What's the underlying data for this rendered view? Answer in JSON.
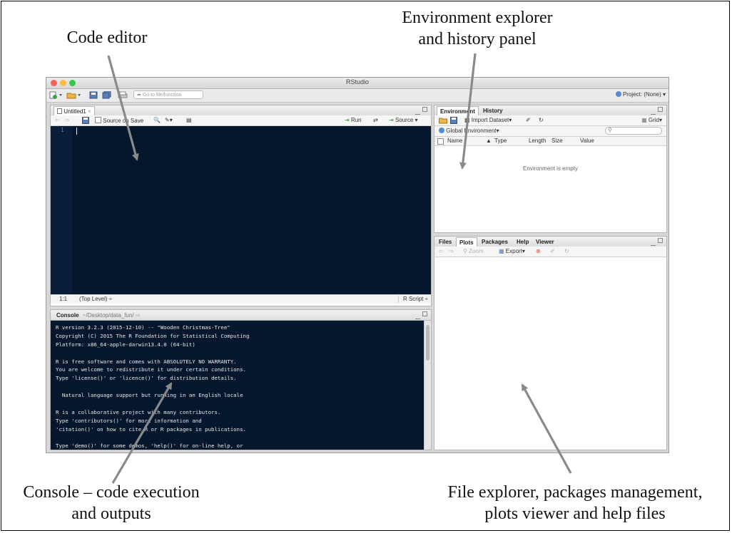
{
  "annotations": {
    "code_editor": "Code editor",
    "environment_line1": "Environment explorer",
    "environment_line2": "and history panel",
    "console_line1": "Console – code execution",
    "console_line2": "and outputs",
    "files_line1": "File explorer, packages management,",
    "files_line2": "plots viewer and help files"
  },
  "window": {
    "title": "RStudio",
    "goto_placeholder": "Go to file/function",
    "project": "Project: (None)",
    "project_arrow": "▾"
  },
  "source_pane": {
    "tab_label": "Untitled1",
    "tab_close": "×",
    "source_on_save": "Source on Save",
    "run_label": "Run",
    "source_label": "Source",
    "line_number": "1",
    "position": "1:1",
    "scope": "(Top Level) ÷",
    "file_type": "R Script ÷"
  },
  "console_pane": {
    "title": "Console",
    "path": "~/Desktop/data_fun/",
    "lines": [
      "R version 3.2.3 (2015-12-10) -- \"Wooden Christmas-Tree\"",
      "Copyright (C) 2015 The R Foundation for Statistical Computing",
      "Platform: x86_64-apple-darwin13.4.0 (64-bit)",
      "",
      "R is free software and comes with ABSOLUTELY NO WARRANTY.",
      "You are welcome to redistribute it under certain conditions.",
      "Type 'license()' or 'licence()' for distribution details.",
      "",
      "  Natural language support but running in an English locale",
      "",
      "R is a collaborative project with many contributors.",
      "Type 'contributors()' for more information and",
      "'citation()' on how to cite R or R packages in publications.",
      "",
      "Type 'demo()' for some demos, 'help()' for on-line help, or"
    ]
  },
  "env_pane": {
    "tabs": [
      "Environment",
      "History"
    ],
    "import_dataset": "Import Dataset",
    "grid": "Grid",
    "global_env": "Global Environment",
    "columns": [
      "Name",
      "Type",
      "Length",
      "Size",
      "Value"
    ],
    "empty_message": "Environment is empty"
  },
  "files_pane": {
    "tabs": [
      "Files",
      "Plots",
      "Packages",
      "Help",
      "Viewer"
    ],
    "zoom": "Zoom",
    "export": "Export"
  },
  "colors": {
    "editor_bg": "#04172d",
    "console_bg": "#04172d",
    "traffic_red": "#fc605b",
    "traffic_yellow": "#fdbc40",
    "traffic_green": "#34c84a",
    "arrow": "#8a8a8a"
  }
}
